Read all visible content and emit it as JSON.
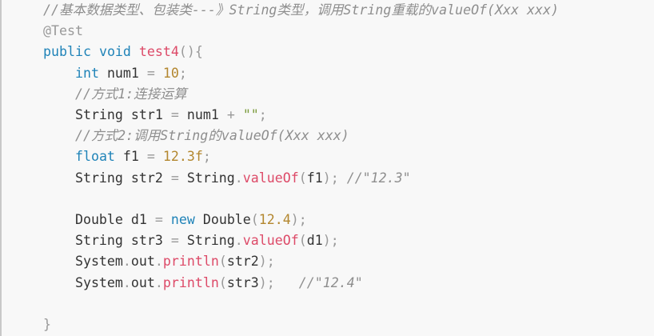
{
  "code_block": {
    "lines": [
      [
        [
          "comment",
          "//基本数据类型、包装类---》String类型，调用String重载的valueOf(Xxx xxx)"
        ]
      ],
      [
        [
          "annotation",
          "@Test"
        ]
      ],
      [
        [
          "keyword",
          "public"
        ],
        [
          "plain",
          " "
        ],
        [
          "keyword",
          "void"
        ],
        [
          "plain",
          " "
        ],
        [
          "func",
          "test4"
        ],
        [
          "punct",
          "(){"
        ]
      ],
      [
        [
          "plain",
          "    "
        ],
        [
          "keyword",
          "int"
        ],
        [
          "plain",
          " num1 "
        ],
        [
          "punct",
          "="
        ],
        [
          "plain",
          " "
        ],
        [
          "number",
          "10"
        ],
        [
          "punct",
          ";"
        ]
      ],
      [
        [
          "plain",
          "    "
        ],
        [
          "comment",
          "//方式1:连接运算"
        ]
      ],
      [
        [
          "plain",
          "    String str1 "
        ],
        [
          "punct",
          "="
        ],
        [
          "plain",
          " num1 "
        ],
        [
          "punct",
          "+"
        ],
        [
          "plain",
          " "
        ],
        [
          "string",
          "\"\""
        ],
        [
          "punct",
          ";"
        ]
      ],
      [
        [
          "plain",
          "    "
        ],
        [
          "comment",
          "//方式2:调用String的valueOf(Xxx xxx)"
        ]
      ],
      [
        [
          "plain",
          "    "
        ],
        [
          "keyword",
          "float"
        ],
        [
          "plain",
          " f1 "
        ],
        [
          "punct",
          "="
        ],
        [
          "plain",
          " "
        ],
        [
          "number",
          "12.3f"
        ],
        [
          "punct",
          ";"
        ]
      ],
      [
        [
          "plain",
          "    String str2 "
        ],
        [
          "punct",
          "="
        ],
        [
          "plain",
          " String"
        ],
        [
          "punct",
          "."
        ],
        [
          "func",
          "valueOf"
        ],
        [
          "punct",
          "("
        ],
        [
          "plain",
          "f1"
        ],
        [
          "punct",
          ");"
        ],
        [
          "plain",
          " "
        ],
        [
          "comment",
          "//\"12.3\""
        ]
      ],
      [],
      [
        [
          "plain",
          "    Double d1 "
        ],
        [
          "punct",
          "="
        ],
        [
          "plain",
          " "
        ],
        [
          "keyword",
          "new"
        ],
        [
          "plain",
          " Double"
        ],
        [
          "punct",
          "("
        ],
        [
          "number",
          "12.4"
        ],
        [
          "punct",
          ");"
        ]
      ],
      [
        [
          "plain",
          "    String str3 "
        ],
        [
          "punct",
          "="
        ],
        [
          "plain",
          " String"
        ],
        [
          "punct",
          "."
        ],
        [
          "func",
          "valueOf"
        ],
        [
          "punct",
          "("
        ],
        [
          "plain",
          "d1"
        ],
        [
          "punct",
          ");"
        ]
      ],
      [
        [
          "plain",
          "    System"
        ],
        [
          "punct",
          "."
        ],
        [
          "plain",
          "out"
        ],
        [
          "punct",
          "."
        ],
        [
          "func",
          "println"
        ],
        [
          "punct",
          "("
        ],
        [
          "plain",
          "str2"
        ],
        [
          "punct",
          ");"
        ]
      ],
      [
        [
          "plain",
          "    System"
        ],
        [
          "punct",
          "."
        ],
        [
          "plain",
          "out"
        ],
        [
          "punct",
          "."
        ],
        [
          "func",
          "println"
        ],
        [
          "punct",
          "("
        ],
        [
          "plain",
          "str3"
        ],
        [
          "punct",
          ");"
        ],
        [
          "plain",
          "   "
        ],
        [
          "comment",
          "//\"12.4\""
        ]
      ],
      [],
      [
        [
          "punct",
          "}"
        ]
      ]
    ]
  }
}
